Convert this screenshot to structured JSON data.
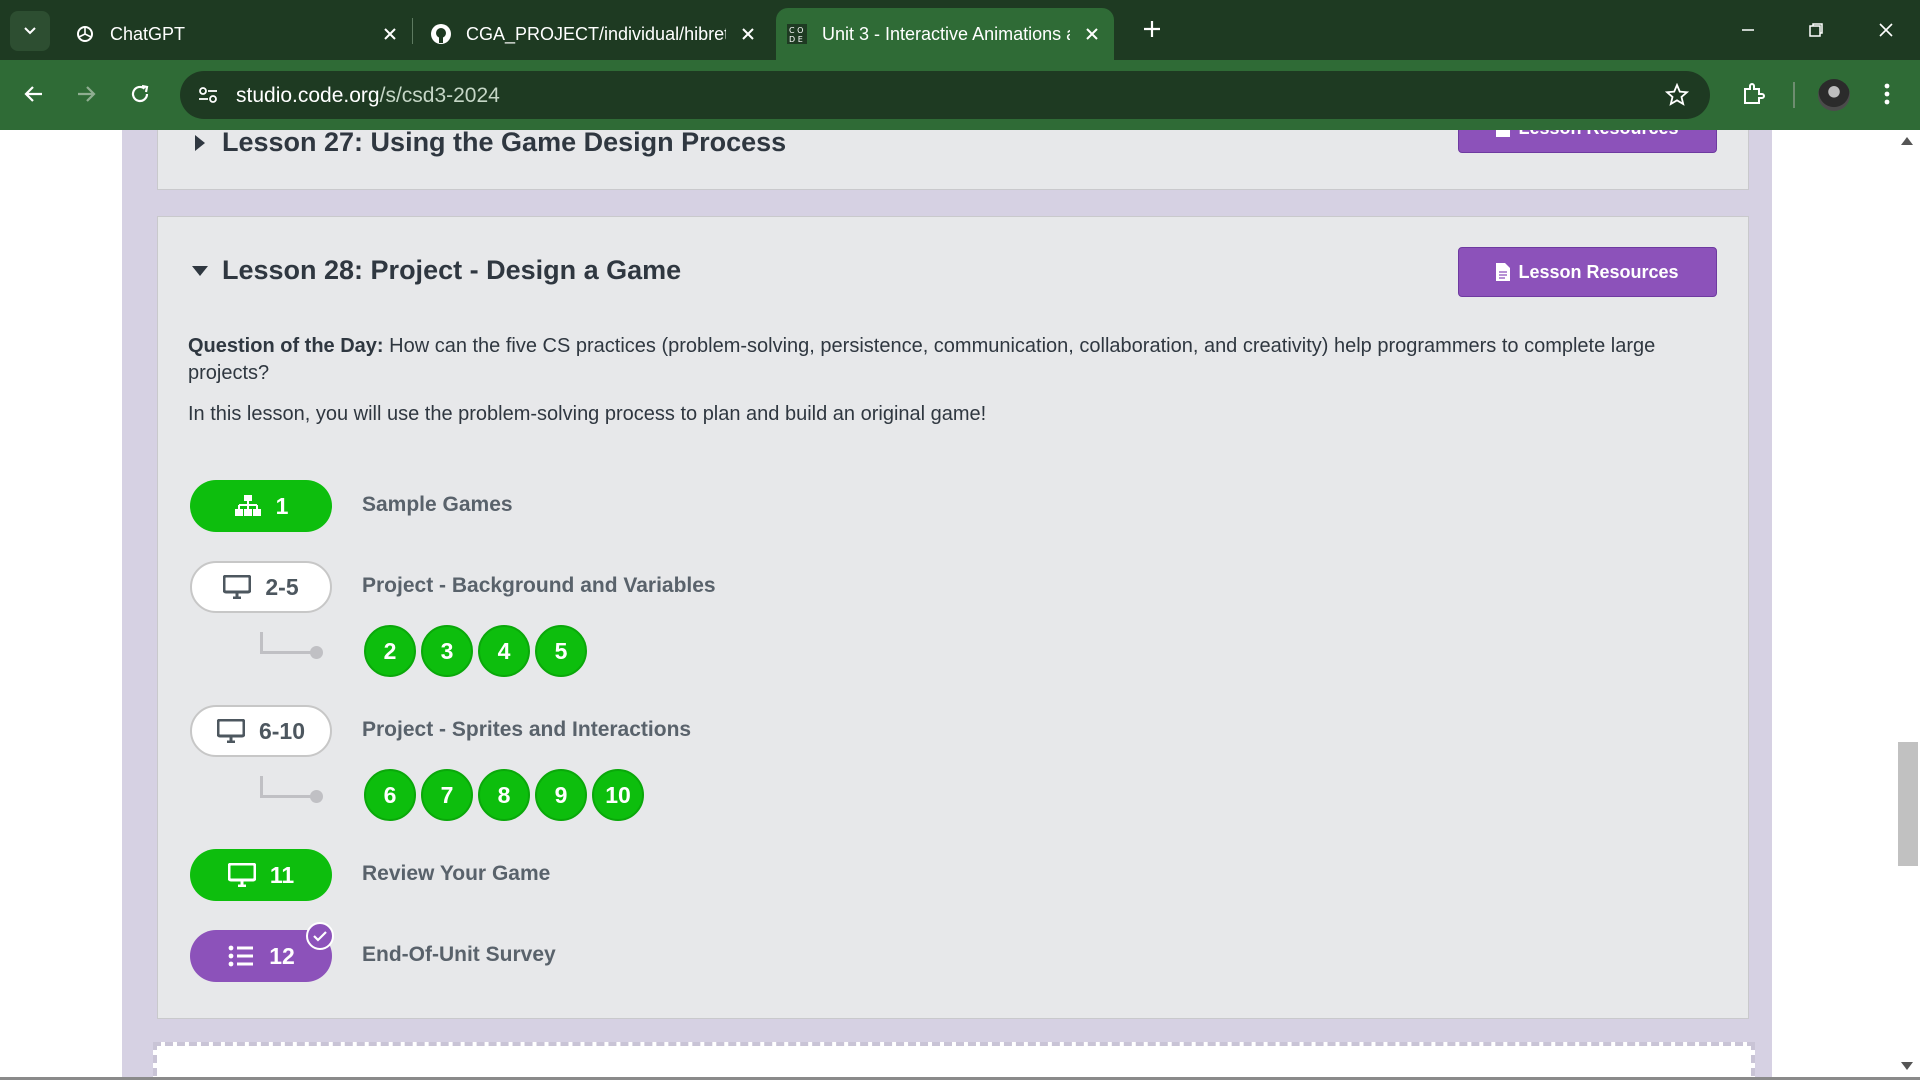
{
  "browser": {
    "tabs": [
      {
        "title": "ChatGPT",
        "icon": "chatgpt-icon"
      },
      {
        "title": "CGA_PROJECT/individual/hibret",
        "icon": "github-icon"
      },
      {
        "title": "Unit 3 - Interactive Animations a",
        "icon": "code-org-icon",
        "active": true
      }
    ],
    "url_host": "studio.code.org",
    "url_path": "/s/csd3-2024"
  },
  "previous_lesson": {
    "title": "Lesson 27: Using the Game Design Process",
    "resources_label": "Lesson Resources"
  },
  "lesson": {
    "title": "Lesson 28: Project - Design a Game",
    "resources_label": "Lesson Resources",
    "qotd_label": "Question of the Day:",
    "qotd_text": " How can the five CS practices (problem-solving, persistence, communication, collaboration, and creativity) help programmers to complete large projects?",
    "description": "In this lesson, you will use the problem-solving process to plan and build an original game!",
    "levels": [
      {
        "number": "1",
        "name": "Sample Games",
        "style": "green",
        "icon": "hierarchy-icon"
      },
      {
        "number": "2-5",
        "name": "Project - Background and Variables",
        "style": "outline",
        "icon": "desktop-icon",
        "sublevels": [
          "2",
          "3",
          "4",
          "5"
        ]
      },
      {
        "number": "6-10",
        "name": "Project - Sprites and Interactions",
        "style": "outline",
        "icon": "desktop-icon",
        "sublevels": [
          "6",
          "7",
          "8",
          "9",
          "10"
        ]
      },
      {
        "number": "11",
        "name": "Review Your Game",
        "style": "green",
        "icon": "desktop-icon"
      },
      {
        "number": "12",
        "name": "End-Of-Unit Survey",
        "style": "purple",
        "icon": "list-icon",
        "checked": true
      }
    ]
  },
  "colors": {
    "chrome_dark": "#1e3a22",
    "chrome_active": "#2f6b36",
    "progress_green": "#0dbe0d",
    "code_purple": "#8c52ba",
    "band_lavender": "#d6d1e3"
  }
}
